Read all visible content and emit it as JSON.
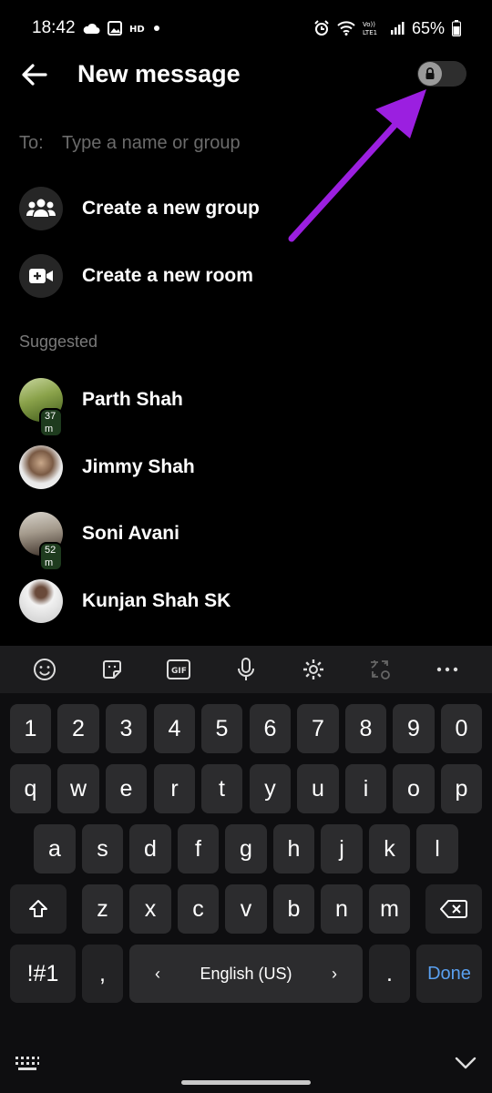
{
  "status_bar": {
    "time": "18:42",
    "battery": "65%",
    "network": "LTE1"
  },
  "header": {
    "title": "New message",
    "secret_toggle": "off"
  },
  "to_field": {
    "label": "To:",
    "placeholder": "Type a name or group"
  },
  "actions": [
    {
      "label": "Create a new group",
      "icon": "group-icon"
    },
    {
      "label": "Create a new room",
      "icon": "video-room-icon"
    }
  ],
  "suggested": {
    "title": "Suggested",
    "contacts": [
      {
        "name": "Parth Shah",
        "active": "37 m"
      },
      {
        "name": "Jimmy Shah",
        "active": ""
      },
      {
        "name": "Soni Avani",
        "active": "52 m"
      },
      {
        "name": "Kunjan Shah SK",
        "active": ""
      }
    ]
  },
  "annotation": {
    "arrow_color": "#9b1fe0",
    "points_to": "secret-conversation-toggle"
  },
  "keyboard": {
    "number_row": [
      "1",
      "2",
      "3",
      "4",
      "5",
      "6",
      "7",
      "8",
      "9",
      "0"
    ],
    "row1": [
      "q",
      "w",
      "e",
      "r",
      "t",
      "y",
      "u",
      "i",
      "o",
      "p"
    ],
    "row2": [
      "a",
      "s",
      "d",
      "f",
      "g",
      "h",
      "j",
      "k",
      "l"
    ],
    "row3": [
      "z",
      "x",
      "c",
      "v",
      "b",
      "n",
      "m"
    ],
    "symbols_key": "!#1",
    "comma_key": ",",
    "space_label": "English (US)",
    "period_key": ".",
    "done_key": "Done"
  },
  "colors": {
    "background": "#000000",
    "key": "#2c2c2e",
    "done": "#5aa0f0",
    "muted_text": "#6b6b6b"
  }
}
